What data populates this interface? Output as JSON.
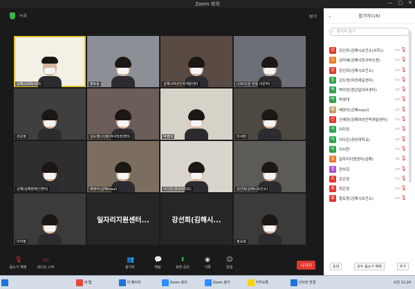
{
  "window": {
    "title": "Zoom 회의",
    "rec_label": "녹화",
    "view_label": "보기"
  },
  "tiles": [
    {
      "name": "김해시의회(사회)",
      "type": "slide"
    },
    {
      "name": "황토동",
      "type": "person"
    },
    {
      "name": "김해시여성인력개발센터",
      "type": "person"
    },
    {
      "name": "나르다(원 전북 이은하)",
      "type": "person"
    },
    {
      "name": "조은정",
      "type": "person"
    },
    {
      "name": "김도영(고(청)여사직장센터)",
      "type": "person"
    },
    {
      "name": "박영대",
      "type": "person"
    },
    {
      "name": "이서현",
      "type": "person"
    },
    {
      "name": "김해(김해장애인센터)",
      "type": "person"
    },
    {
      "name": "배영아(김해maul)",
      "type": "person"
    },
    {
      "name": "이다은(경성대학교)",
      "type": "person"
    },
    {
      "name": "강선희(김해시보건소)",
      "type": "person"
    },
    {
      "name": "이미정",
      "type": "person"
    },
    {
      "name": "일자리지원센터...",
      "type": "text"
    },
    {
      "name": "강선희(김해시...",
      "type": "text"
    },
    {
      "name": "정숙희",
      "type": "person"
    }
  ],
  "toolbar": {
    "mute": "음소거 해제",
    "video": "비디오 시작",
    "participants": "참가자",
    "participants_count": "16",
    "chat": "채팅",
    "chat_badge": "2",
    "share": "화면 공유",
    "record": "기록",
    "react": "반응",
    "end": "나가기"
  },
  "panel": {
    "title": "참가자(16)",
    "search_placeholder": "참가자 찾기",
    "participants": [
      {
        "avatar": "강",
        "name": "강선주(김해시보건소(사회))",
        "color": "#e0382f"
      },
      {
        "avatar": "김",
        "name": "김미혜(김해사회서비스원)",
        "color": "#e8782a"
      },
      {
        "avatar": "강",
        "name": "강선희(김해시보건소)",
        "color": "#d93c2c"
      },
      {
        "avatar": "김",
        "name": "김도영(여성새일센터)",
        "color": "#2fa24b"
      },
      {
        "avatar": "박",
        "name": "박미정(청년일자리센터)",
        "color": "#2fa24b"
      },
      {
        "avatar": "박",
        "name": "박영대",
        "color": "#2fa24b"
      },
      {
        "avatar": "배",
        "name": "배영아(김해maul)",
        "color": "#c9a06c"
      },
      {
        "avatar": "신",
        "name": "신혜정(김해여성인력개발센터)",
        "color": "#e0382f"
      },
      {
        "avatar": "이",
        "name": "이미정",
        "color": "#2fa24b"
      },
      {
        "avatar": "이",
        "name": "이다은(경성대학교)",
        "color": "#2fa24b"
      },
      {
        "avatar": "이",
        "name": "이서현",
        "color": "#2fa24b"
      },
      {
        "avatar": "일",
        "name": "일자리지원센터(김해)",
        "color": "#e8782a"
      },
      {
        "avatar": "정",
        "name": "정숙희",
        "color": "#b04ad0"
      },
      {
        "avatar": "조",
        "name": "조은정",
        "color": "#e0382f"
      },
      {
        "avatar": "최",
        "name": "최은정",
        "color": "#e0382f"
      },
      {
        "avatar": "황",
        "name": "황토동(김해시보건소)",
        "color": "#e0382f"
      }
    ],
    "invite": "초대",
    "mute_all": "모두 음소거 해제",
    "more": "추가"
  },
  "taskbar": {
    "items": [
      "새 탭",
      "이 페이지",
      "Zoom 회의",
      "Zoom 참가",
      "카카오톡",
      "인터넷 연결"
    ],
    "time": "오전 11:24"
  }
}
